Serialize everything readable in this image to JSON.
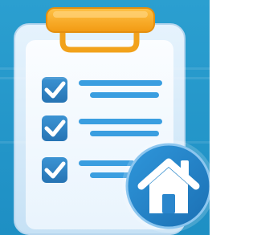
{
  "colors": {
    "background": "#1f93c8",
    "clipboard_board": "#d9ecfb",
    "clipboard_paper": "#f4f9ff",
    "clip_orange": "#f6a623",
    "clip_orange_dark": "#e08a12",
    "checkbox_blue": "#2f86c8",
    "line_blue": "#3a9ee0",
    "badge_blue": "#1f7fc4",
    "house_white": "#ffffff"
  },
  "icons": {
    "clipboard": "clipboard-icon",
    "clip": "clip-icon",
    "checkbox": "checkbox-checked-icon",
    "home": "home-icon"
  },
  "checklist": {
    "items": [
      {
        "checked": true
      },
      {
        "checked": true
      },
      {
        "checked": true
      }
    ]
  }
}
